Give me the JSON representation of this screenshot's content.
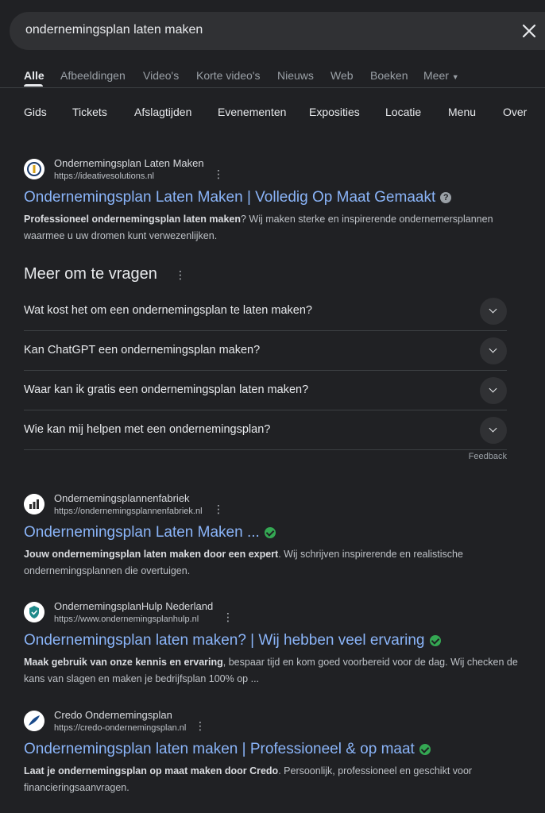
{
  "search": {
    "query": "ondernemingsplan laten maken"
  },
  "tabs": [
    "Alle",
    "Afbeeldingen",
    "Video's",
    "Korte video's",
    "Nieuws",
    "Web",
    "Boeken",
    "Meer"
  ],
  "filters": [
    "Gids",
    "Tickets",
    "Afslagtijden",
    "Evenementen",
    "Exposities",
    "Locatie",
    "Menu",
    "Over"
  ],
  "results": [
    {
      "site_name": "Ondernemingsplan Laten Maken",
      "url": "https://ideativesolutions.nl",
      "title": "Ondernemingsplan Laten Maken | Volledig Op Maat Gemaakt",
      "snippet_bold": "Professioneel ondernemingsplan laten maken",
      "snippet_rest": "? Wij maken sterke en inspirerende ondernemersplannen waarmee u uw dromen kunt verwezenlijken.",
      "favicon": "shield-i-icon"
    },
    {
      "site_name": "Ondernemingsplannenfabriek",
      "url": "https://ondernemingsplannenfabriek.nl",
      "title": "Ondernemingsplan Laten Maken ...",
      "snippet_bold": "Jouw ondernemingsplan laten maken door een expert",
      "snippet_rest": ". Wij schrijven inspirerende en realistische ondernemingsplannen die overtuigen.",
      "favicon": "bar-chart-icon"
    },
    {
      "site_name": "OndernemingsplanHulp Nederland",
      "url": "https://www.ondernemingsplanhulp.nl",
      "title": "Ondernemingsplan laten maken? | Wij hebben veel ervaring",
      "snippet_bold": "Maak gebruik van onze kennis en ervaring",
      "snippet_rest": ", bespaar tijd en kom goed voorbereid voor de dag. Wij checken de kans van slagen en maken je bedrijfsplan 100% op ...",
      "favicon": "shield-teal-icon"
    },
    {
      "site_name": "Credo Ondernemingsplan",
      "url": "https://credo-ondernemingsplan.nl",
      "title": "Ondernemingsplan laten maken | Professioneel & op maat",
      "snippet_bold": "Laat je ondernemingsplan op maat maken door Credo",
      "snippet_rest": ". Persoonlijk, professioneel en geschikt voor financieringsaanvragen.",
      "favicon": "feather-icon"
    }
  ],
  "paa": {
    "title": "Meer om te vragen",
    "questions": [
      "Wat kost het om een ondernemingsplan te laten maken?",
      "Kan ChatGPT een ondernemingsplan maken?",
      "Waar kan ik gratis een ondernemingsplan laten maken?",
      "Wie kan mij helpen met een ondernemingsplan?"
    ],
    "feedback": "Feedback"
  },
  "colors": {
    "background": "#202124",
    "link": "#8ab4f8",
    "verified": "#34a853"
  }
}
